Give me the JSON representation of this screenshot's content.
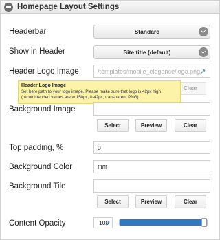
{
  "panel": {
    "title": "Homepage Layout Settings"
  },
  "fields": {
    "headerbar": {
      "label": "Headerbar",
      "value": "Standard"
    },
    "show_in_header": {
      "label": "Show in Header",
      "value": "Site title (default)"
    },
    "header_logo": {
      "label": "Header Logo Image",
      "placeholder": "/templates/mobile_elegance/logo.png",
      "clear_label": "Clear"
    },
    "background_image": {
      "label": "Background Image",
      "value": "",
      "select_label": "Select",
      "preview_label": "Preview",
      "clear_label": "Clear"
    },
    "top_padding": {
      "label": "Top padding, %",
      "value": "0"
    },
    "background_color": {
      "label": "Background Color",
      "value": "ffffff"
    },
    "background_tile": {
      "label": "Background Tile",
      "value": "",
      "select_label": "Select",
      "preview_label": "Preview",
      "clear_label": "Clear"
    },
    "content_opacity": {
      "label": "Content Opacity",
      "value": "100",
      "level": 1.0
    }
  },
  "tooltip": {
    "title": "Header Logo Image",
    "body": "Set here path to your logo image. Please make sure that logo is 42px high (recommended values are w:150px, h:42px, transparent PNG)"
  },
  "colors": {
    "accent": "#2f78c4",
    "tooltip_bg": "#fdf3a8"
  },
  "icons": {
    "collapse": "minus-circle-icon",
    "dropdown": "chevron-down-icon",
    "picker": "eyedropper-icon"
  }
}
